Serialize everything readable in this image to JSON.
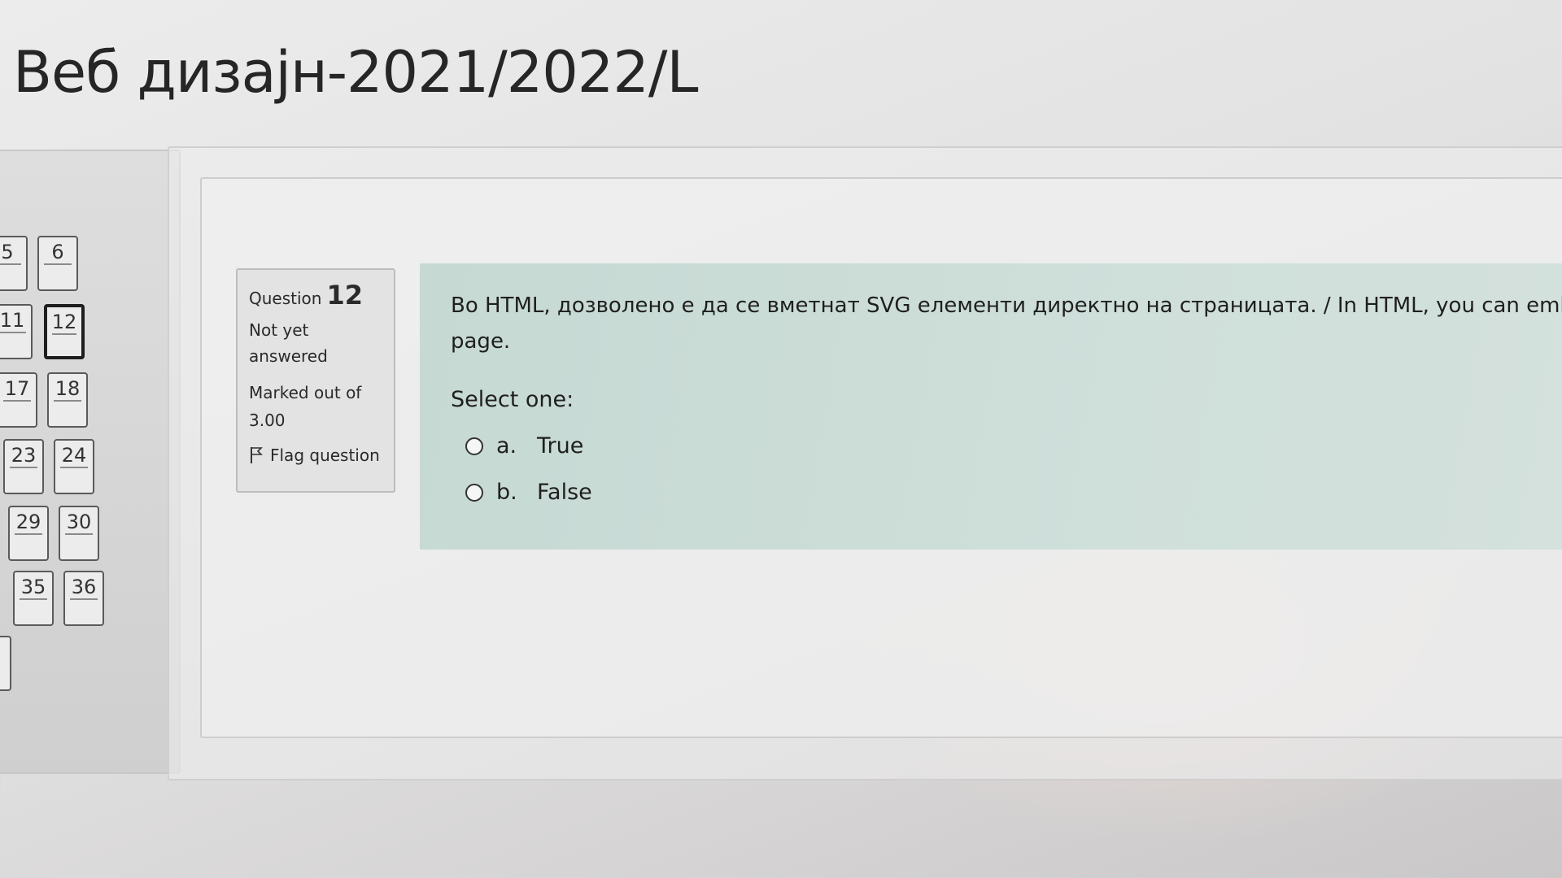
{
  "page": {
    "title": "Веб дизајн-2021/2022/L"
  },
  "navigation": {
    "buttons": [
      {
        "label": "5"
      },
      {
        "label": "6"
      },
      {
        "label": "11"
      },
      {
        "label": "12",
        "current": true
      },
      {
        "label": "17"
      },
      {
        "label": "18"
      },
      {
        "label": "23"
      },
      {
        "label": "24"
      },
      {
        "label": "29"
      },
      {
        "label": "30"
      },
      {
        "label": "35"
      },
      {
        "label": "36"
      }
    ]
  },
  "question": {
    "label": "Question",
    "number": "12",
    "state_line1": "Not yet",
    "state_line2": "answered",
    "grade_line1": "Marked out of",
    "grade_line2": "3.00",
    "flag_label": "Flag question",
    "text_line1": "Во HTML, дозволено е да се вметнат SVG елементи директно на страницата. / In HTML, you can embed S",
    "text_line2": "page.",
    "prompt": "Select one:",
    "answers": [
      {
        "letter": "a.",
        "label": "True"
      },
      {
        "letter": "b.",
        "label": "False"
      }
    ]
  },
  "colors": {
    "formulation_bg": "#c6d9d3",
    "current_border": "#1e1e1e"
  },
  "icons": [
    "flag-icon",
    "radio-icon"
  ]
}
